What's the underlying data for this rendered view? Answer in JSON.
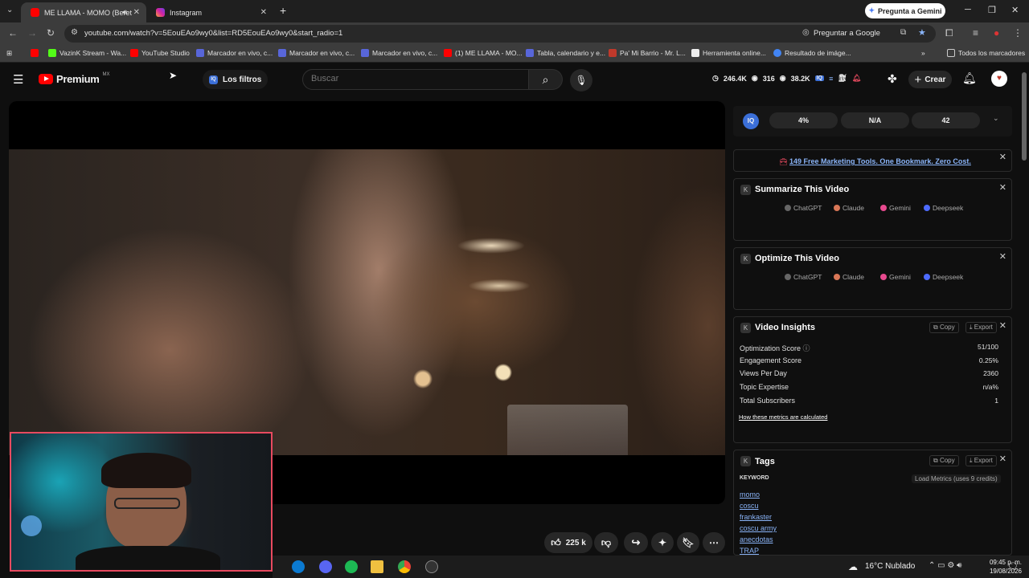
{
  "browser": {
    "tabs": [
      {
        "title": "ME LLAMA - MOMO (Beret",
        "active": true
      },
      {
        "title": "Instagram",
        "active": false
      }
    ],
    "gemini_button": "Pregunta a Gemini",
    "url": "youtube.com/watch?v=5EouEAo9wy0&list=RD5EouEAo9wy0&start_radio=1",
    "ask_google": "Preguntar a Google",
    "bookmarks": [
      "VazinK Stream - Wa...",
      "YouTube Studio",
      "Marcador en vivo, c...",
      "Marcador en vivo, c...",
      "Marcador en vivo, c...",
      "(1) ME LLAMA - MO...",
      "Tabla, calendario y e...",
      "Pa' Mi Barrio - Mr. L...",
      "Herramienta online...",
      "Resultado de imáge..."
    ],
    "all_bookmarks": "Todos los marcadores"
  },
  "youtube": {
    "logo_text": "Premium",
    "region": "MX",
    "filters_label": "Los filtros",
    "search_placeholder": "Buscar",
    "stats": {
      "views": "246.4K",
      "watching": "316",
      "eyes": "38.2K"
    },
    "create_label": "Crear",
    "likes": "225 k"
  },
  "extension": {
    "iq_stats": [
      "4%",
      "N/A",
      "42"
    ],
    "promo": "149 Free Marketing Tools. One Bookmark. Zero Cost.",
    "summarize_title": "Summarize This Video",
    "optimize_title": "Optimize This Video",
    "ai_buttons": [
      "ChatGPT",
      "Claude",
      "Gemini",
      "Deepseek"
    ],
    "insights_title": "Video Insights",
    "copy_label": "Copy",
    "export_label": "Export",
    "metrics": [
      {
        "label": "Optimization Score",
        "value": "51/100"
      },
      {
        "label": "Engagement Score",
        "value": "0.25%"
      },
      {
        "label": "Views Per Day",
        "value": "2360"
      },
      {
        "label": "Topic Expertise",
        "value": "n/a%"
      },
      {
        "label": "Total Subscribers",
        "value": "1"
      }
    ],
    "metrics_link": "How these metrics are calculated",
    "tags_title": "Tags",
    "keyword_header": "KEYWORD",
    "load_metrics": "Load Metrics (uses 9 credits)",
    "tags": [
      "momo",
      "coscu",
      "frankaster",
      "coscu army",
      "anecdotas",
      "TRAP"
    ]
  },
  "taskbar": {
    "weather": "16°C  Nublado",
    "time": "09:45 p. m.",
    "date": "19/08/2026"
  }
}
